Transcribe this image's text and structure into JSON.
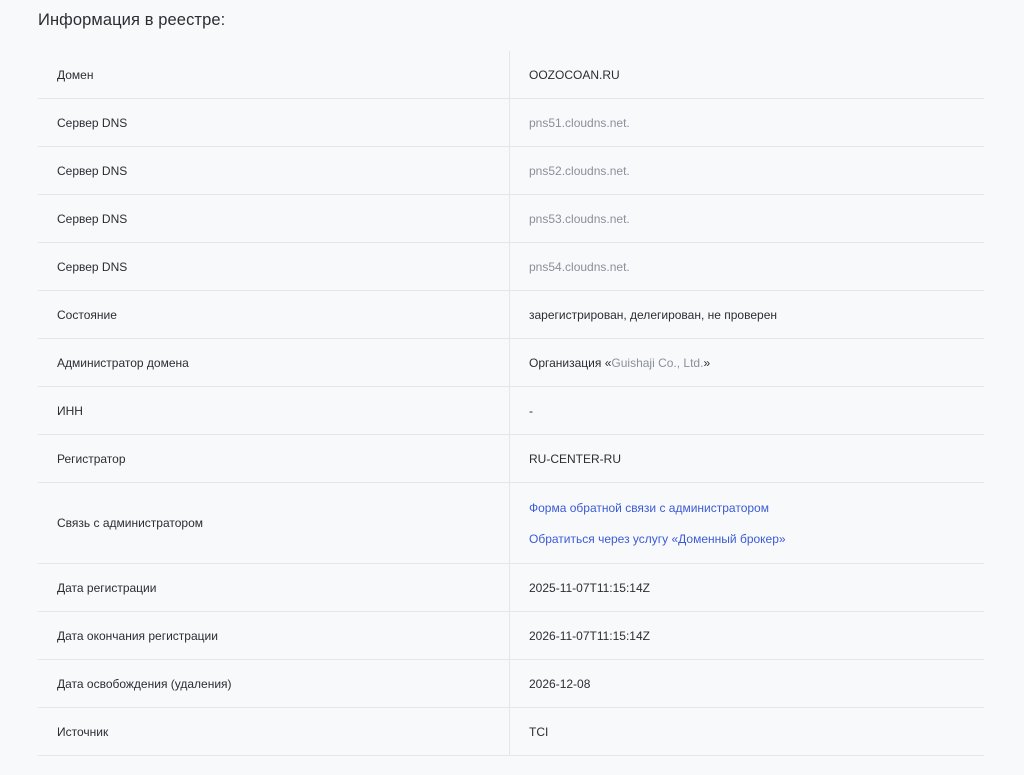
{
  "page": {
    "title": "Информация в реестре:"
  },
  "rows": [
    {
      "label": "Домен",
      "value": "OOZOCOAN.RU"
    },
    {
      "label": "Сервер DNS",
      "value": "pns51.cloudns.net."
    },
    {
      "label": "Сервер DNS",
      "value": "pns52.cloudns.net."
    },
    {
      "label": "Сервер DNS",
      "value": "pns53.cloudns.net."
    },
    {
      "label": "Сервер DNS",
      "value": "pns54.cloudns.net."
    },
    {
      "label": "Состояние",
      "value": "зарегистрирован, делегирован, не проверен"
    },
    {
      "label": "Администратор домена",
      "value_prefix": "Организация «",
      "value_name": "Guishaji Co., Ltd.",
      "value_suffix": "»"
    },
    {
      "label": "ИНН",
      "value": "-"
    },
    {
      "label": "Регистратор",
      "value": "RU-CENTER-RU"
    },
    {
      "label": "Связь с администратором",
      "links": [
        "Форма обратной связи с администратором",
        "Обратиться через услугу «Доменный брокер»"
      ]
    },
    {
      "label": "Дата регистрации",
      "value": "2025-11-07T11:15:14Z"
    },
    {
      "label": "Дата окончания регистрации",
      "value": "2026-11-07T11:15:14Z"
    },
    {
      "label": "Дата освобождения (удаления)",
      "value": "2026-12-08"
    },
    {
      "label": "Источник",
      "value": "TCI"
    }
  ],
  "colors": {
    "background": "#f8f9fb",
    "text": "#2b2d33",
    "muted_text": "#8a8f99",
    "link": "#3b5bd6",
    "divider": "#e4e6ea"
  }
}
